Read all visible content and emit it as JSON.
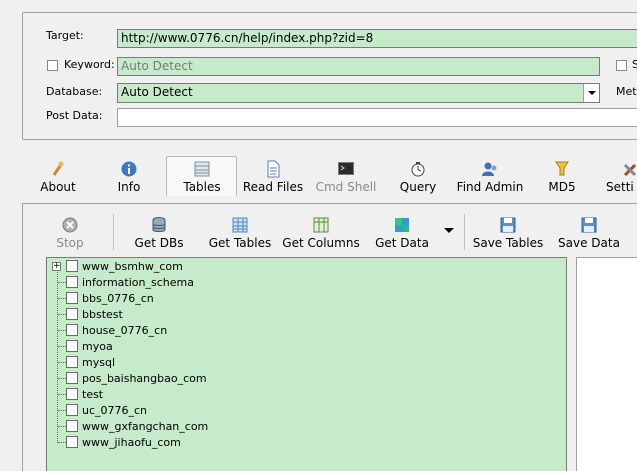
{
  "form": {
    "target_label": "Target:",
    "target_value": "http://www.0776.cn/help/index.php?zid=8",
    "keyword_label": "Keyword:",
    "keyword_value": "Auto Detect",
    "database_label": "Database:",
    "database_value": "Auto Detect",
    "postdata_label": "Post Data:",
    "postdata_value": "",
    "right_check_label": "S",
    "method_label": "Meth"
  },
  "main_toolbar": [
    {
      "label": "About",
      "icon": "about-icon"
    },
    {
      "label": "Info",
      "icon": "info-icon"
    },
    {
      "label": "Tables",
      "icon": "tables-icon",
      "active": true
    },
    {
      "label": "Read Files",
      "icon": "read-files-icon"
    },
    {
      "label": "Cmd Shell",
      "icon": "cmd-shell-icon",
      "disabled": true
    },
    {
      "label": "Query",
      "icon": "query-icon"
    },
    {
      "label": "Find Admin",
      "icon": "find-admin-icon"
    },
    {
      "label": "MD5",
      "icon": "md5-icon"
    },
    {
      "label": "Setti",
      "icon": "settings-icon"
    }
  ],
  "sub_toolbar": [
    {
      "label": "Stop",
      "icon": "stop-icon",
      "disabled": true
    },
    {
      "label": "Get DBs",
      "icon": "get-dbs-icon"
    },
    {
      "label": "Get Tables",
      "icon": "get-tables-icon"
    },
    {
      "label": "Get Columns",
      "icon": "get-columns-icon"
    },
    {
      "label": "Get Data",
      "icon": "get-data-icon"
    },
    {
      "label": "Save Tables",
      "icon": "save-tables-icon"
    },
    {
      "label": "Save Data",
      "icon": "save-data-icon"
    }
  ],
  "databases": [
    "www_bsmhw_com",
    "information_schema",
    "bbs_0776_cn",
    "bbstest",
    "house_0776_cn",
    "myoa",
    "mysql",
    "pos_baishangbao_com",
    "test",
    "uc_0776_cn",
    "www_gxfangchan_com",
    "www_jihaofu_com"
  ],
  "colors": {
    "field_bg": "#c5ebcb",
    "window_bg": "#f0f0f0"
  }
}
